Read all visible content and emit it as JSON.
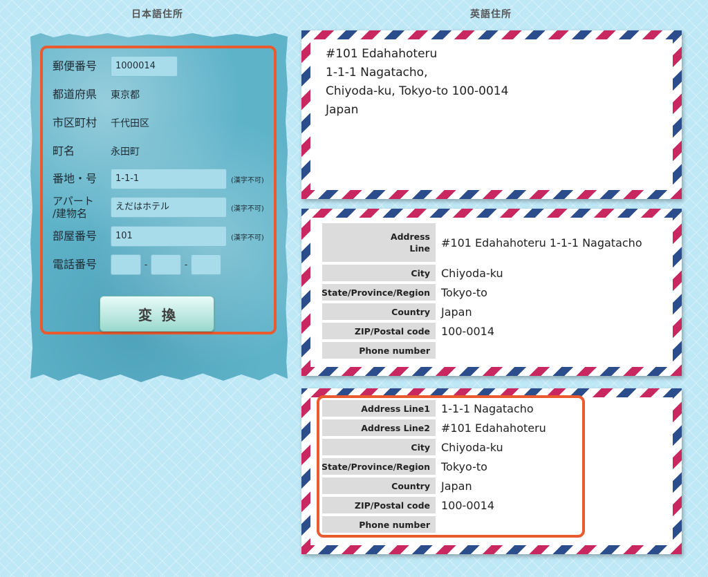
{
  "headings": {
    "japanese": "日本語住所",
    "english": "英語住所"
  },
  "jp_form": {
    "postal": {
      "label": "郵便番号",
      "value": "1000014"
    },
    "prefecture": {
      "label": "都道府県",
      "value": "東京都"
    },
    "city": {
      "label": "市区町村",
      "value": "千代田区"
    },
    "town": {
      "label": "町名",
      "value": "永田町"
    },
    "block": {
      "label": "番地・号",
      "value": "1-1-1",
      "note": "(漢字不可)"
    },
    "building": {
      "label_line1": "アパート",
      "label_line2": "/建物名",
      "value": "えだはホテル",
      "note": "(漢字不可)"
    },
    "room": {
      "label": "部屋番号",
      "value": "101",
      "note": "(漢字不可)"
    },
    "phone": {
      "label": "電話番号",
      "part1": "",
      "part2": "",
      "part3": "",
      "separator": "-"
    },
    "convert_label": "変換"
  },
  "envelope1": {
    "lines": [
      "#101 Edahahoteru",
      "1-1-1 Nagatacho,",
      "Chiyoda-ku, Tokyo-to 100-0014",
      "Japan"
    ]
  },
  "envelope2": {
    "rows": [
      {
        "label_line1": "Address",
        "label_line2": "Line",
        "value": "#101 Edahahoteru 1-1-1 Nagatacho"
      },
      {
        "label": "City",
        "value": "Chiyoda-ku"
      },
      {
        "label": "State/Province/Region",
        "value": "Tokyo-to"
      },
      {
        "label": "Country",
        "value": "Japan"
      },
      {
        "label": "ZIP/Postal code",
        "value": "100-0014"
      },
      {
        "label": "Phone number",
        "value": ""
      }
    ]
  },
  "envelope3": {
    "rows": [
      {
        "label": "Address Line1",
        "value": "1-1-1 Nagatacho"
      },
      {
        "label": "Address Line2",
        "value": "#101 Edahahoteru"
      },
      {
        "label": "City",
        "value": "Chiyoda-ku"
      },
      {
        "label": "State/Province/Region",
        "value": "Tokyo-to"
      },
      {
        "label": "Country",
        "value": "Japan"
      },
      {
        "label": "ZIP/Postal code",
        "value": "100-0014"
      },
      {
        "label": "Phone number",
        "value": ""
      }
    ]
  },
  "colors": {
    "highlight_frame": "#ea5a2f",
    "stripe_red": "#c8285f",
    "stripe_blue": "#2c4d8c",
    "panel": "#5fb3c9"
  }
}
